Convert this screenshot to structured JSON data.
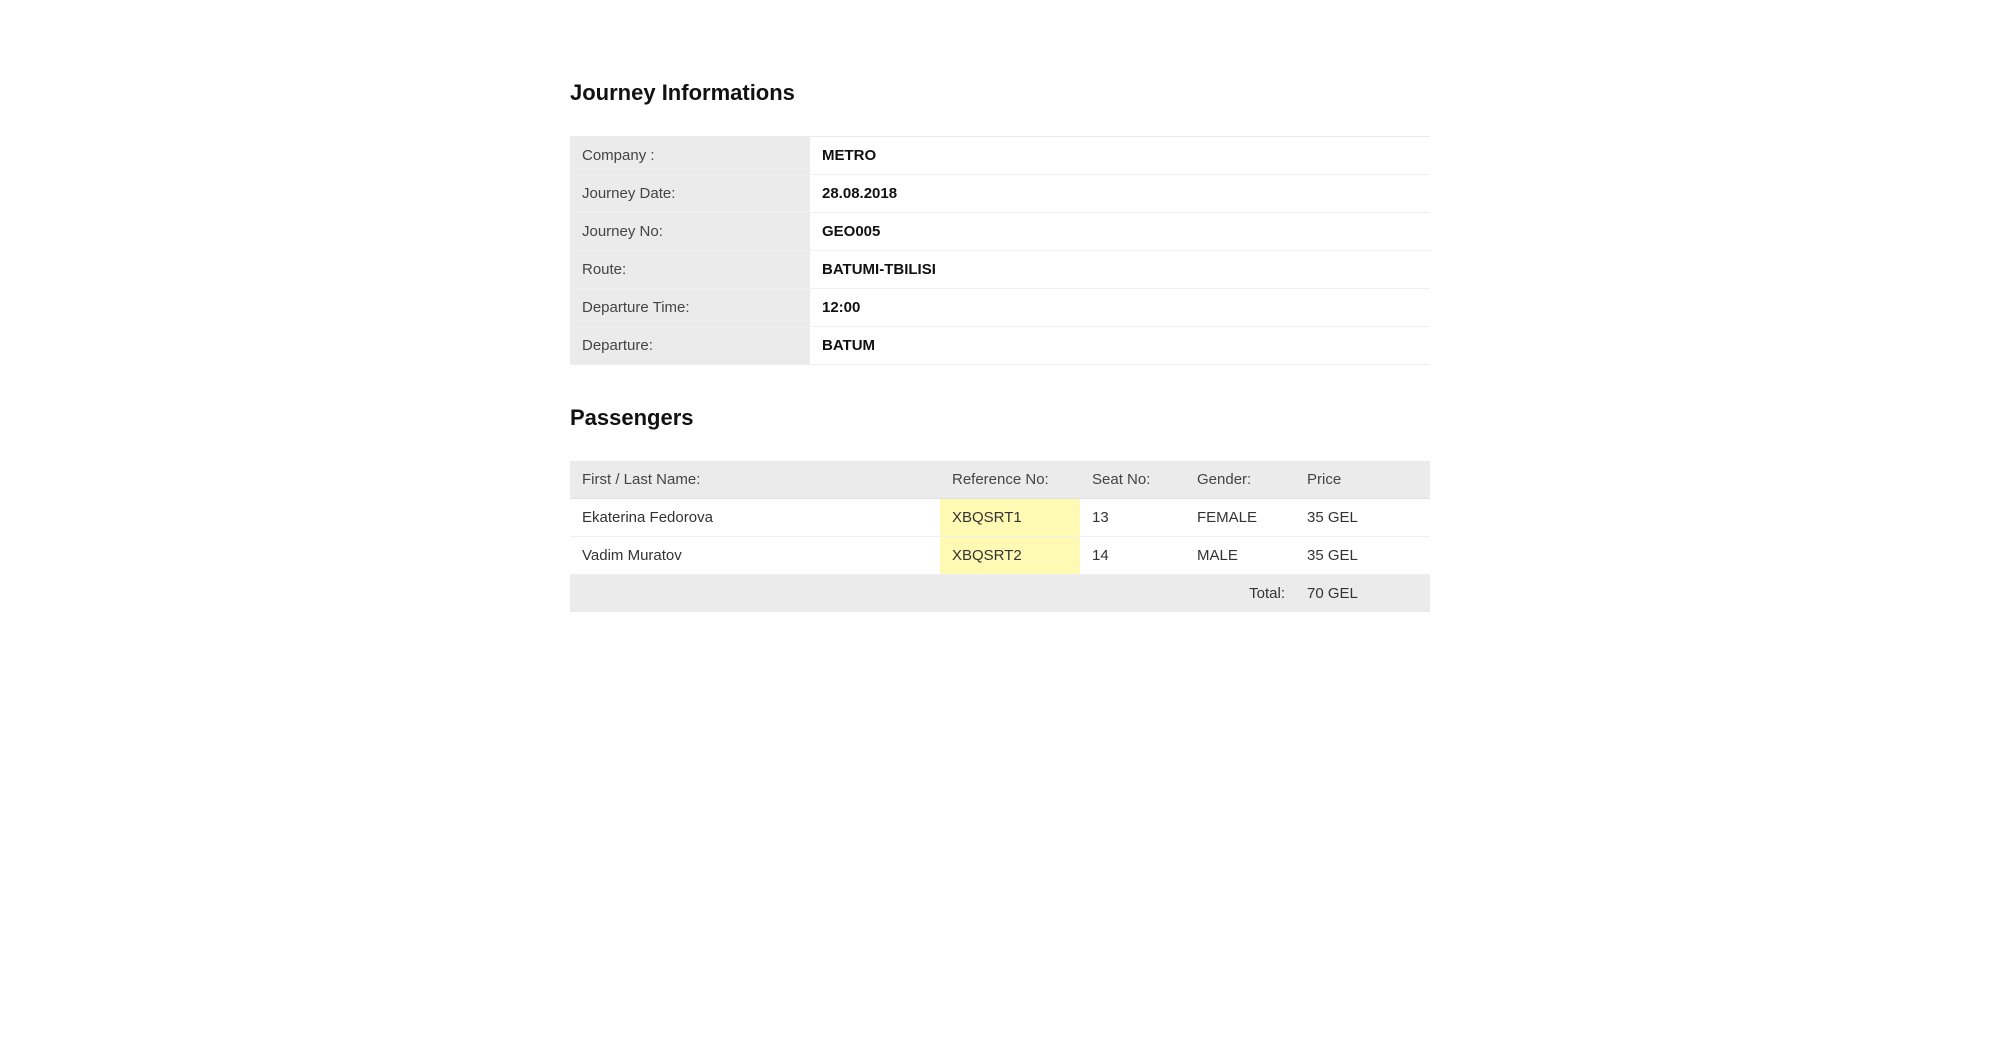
{
  "journey": {
    "heading": "Journey Informations",
    "rows": [
      {
        "label": "Company :",
        "value": "METRO"
      },
      {
        "label": "Journey Date:",
        "value": "28.08.2018"
      },
      {
        "label": "Journey No:",
        "value": "GEO005"
      },
      {
        "label": "Route:",
        "value": "BATUMI-TBILISI"
      },
      {
        "label": "Departure Time:",
        "value": "12:00"
      },
      {
        "label": "Departure:",
        "value": "BATUM"
      }
    ]
  },
  "passengers": {
    "heading": "Passengers",
    "columns": {
      "name": "First / Last Name:",
      "ref": "Reference No:",
      "seat": "Seat No:",
      "gender": "Gender:",
      "price": "Price"
    },
    "rows": [
      {
        "name": "Ekaterina Fedorova",
        "ref": "XBQSRT1",
        "seat": "13",
        "gender": "FEMALE",
        "price": "35 GEL"
      },
      {
        "name": "Vadim Muratov",
        "ref": "XBQSRT2",
        "seat": "14",
        "gender": "MALE",
        "price": "35 GEL"
      }
    ],
    "total_label": "Total:",
    "total_value": "70 GEL"
  }
}
